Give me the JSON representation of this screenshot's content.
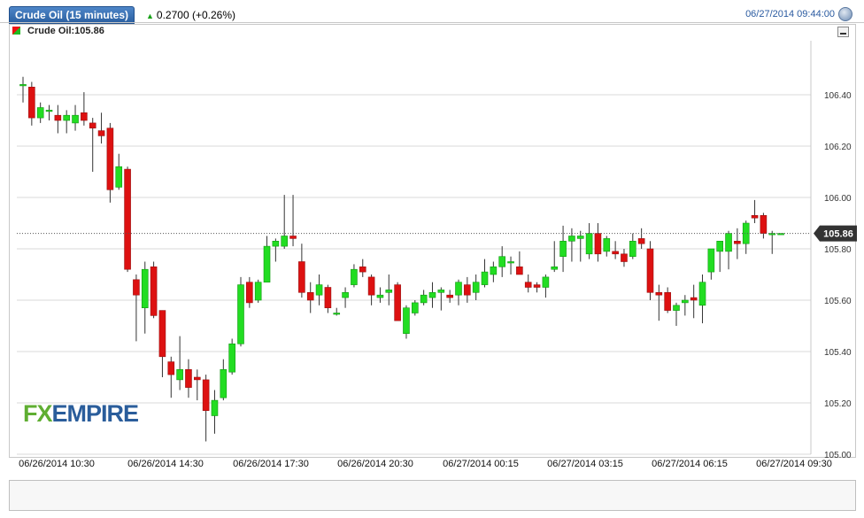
{
  "header": {
    "instrument_tab": "Crude Oil (15 minutes)",
    "change_text": "0.2700 (+0.26%)",
    "datetime": "06/27/2014 09:44:00"
  },
  "legend": {
    "label": "Crude Oil:105.86"
  },
  "logo": {
    "part1": "FX",
    "part2": "EMPIRE"
  },
  "colors": {
    "up": "#22dd22",
    "down": "#dd1111",
    "grid": "#d9d9d9",
    "accent": "#2a5aa0"
  },
  "chart_data": {
    "type": "candlestick",
    "last_price": 105.86,
    "last_price_label": "105.86",
    "ylim": [
      105.0,
      106.6
    ],
    "yticks": [
      105.0,
      105.2,
      105.4,
      105.6,
      105.8,
      106.0,
      106.2,
      106.4
    ],
    "ytick_labels": [
      "105.00",
      "105.20",
      "105.40",
      "105.60",
      "105.80",
      "106.00",
      "106.20",
      "106.40"
    ],
    "xtick_labels": [
      "06/26/2014 10:30",
      "06/26/2014 14:30",
      "06/26/2014 17:30",
      "06/26/2014 20:30",
      "06/27/2014 00:15",
      "06/27/2014 03:15",
      "06/27/2014 06:15",
      "06/27/2014 09:30"
    ],
    "candles": [
      [
        106.44,
        106.47,
        106.37,
        106.44
      ],
      [
        106.43,
        106.45,
        106.28,
        106.31
      ],
      [
        106.31,
        106.37,
        106.29,
        106.35
      ],
      [
        106.34,
        106.36,
        106.3,
        106.34
      ],
      [
        106.32,
        106.36,
        106.25,
        106.3
      ],
      [
        106.3,
        106.34,
        106.25,
        106.32
      ],
      [
        106.29,
        106.36,
        106.26,
        106.32
      ],
      [
        106.33,
        106.41,
        106.28,
        106.3
      ],
      [
        106.29,
        106.31,
        106.1,
        106.27
      ],
      [
        106.26,
        106.33,
        106.21,
        106.24
      ],
      [
        106.27,
        106.29,
        105.98,
        106.03
      ],
      [
        106.04,
        106.17,
        106.03,
        106.12
      ],
      [
        106.11,
        106.12,
        105.71,
        105.72
      ],
      [
        105.68,
        105.7,
        105.44,
        105.62
      ],
      [
        105.57,
        105.75,
        105.47,
        105.72
      ],
      [
        105.73,
        105.75,
        105.53,
        105.54
      ],
      [
        105.56,
        105.56,
        105.3,
        105.38
      ],
      [
        105.36,
        105.38,
        105.22,
        105.31
      ],
      [
        105.29,
        105.46,
        105.25,
        105.33
      ],
      [
        105.33,
        105.37,
        105.22,
        105.26
      ],
      [
        105.3,
        105.33,
        105.21,
        105.29
      ],
      [
        105.29,
        105.31,
        105.05,
        105.17
      ],
      [
        105.15,
        105.25,
        105.08,
        105.21
      ],
      [
        105.22,
        105.37,
        105.21,
        105.33
      ],
      [
        105.32,
        105.45,
        105.31,
        105.43
      ],
      [
        105.43,
        105.69,
        105.42,
        105.66
      ],
      [
        105.67,
        105.69,
        105.57,
        105.59
      ],
      [
        105.6,
        105.68,
        105.59,
        105.67
      ],
      [
        105.67,
        105.85,
        105.67,
        105.81
      ],
      [
        105.81,
        105.84,
        105.75,
        105.83
      ],
      [
        105.81,
        106.01,
        105.8,
        105.85
      ],
      [
        105.85,
        106.01,
        105.81,
        105.84
      ],
      [
        105.75,
        105.82,
        105.61,
        105.63
      ],
      [
        105.63,
        105.67,
        105.55,
        105.6
      ],
      [
        105.62,
        105.7,
        105.58,
        105.66
      ],
      [
        105.65,
        105.66,
        105.55,
        105.57
      ],
      [
        105.55,
        105.57,
        105.54,
        105.55
      ],
      [
        105.61,
        105.65,
        105.57,
        105.63
      ],
      [
        105.66,
        105.74,
        105.65,
        105.72
      ],
      [
        105.73,
        105.76,
        105.69,
        105.71
      ],
      [
        105.69,
        105.7,
        105.58,
        105.62
      ],
      [
        105.61,
        105.65,
        105.59,
        105.62
      ],
      [
        105.63,
        105.7,
        105.58,
        105.64
      ],
      [
        105.66,
        105.67,
        105.52,
        105.52
      ],
      [
        105.47,
        105.58,
        105.45,
        105.57
      ],
      [
        105.55,
        105.6,
        105.54,
        105.59
      ],
      [
        105.59,
        105.64,
        105.58,
        105.62
      ],
      [
        105.61,
        105.67,
        105.57,
        105.63
      ],
      [
        105.63,
        105.65,
        105.56,
        105.64
      ],
      [
        105.62,
        105.64,
        105.59,
        105.61
      ],
      [
        105.62,
        105.68,
        105.58,
        105.67
      ],
      [
        105.66,
        105.69,
        105.59,
        105.62
      ],
      [
        105.63,
        105.7,
        105.6,
        105.67
      ],
      [
        105.66,
        105.76,
        105.65,
        105.71
      ],
      [
        105.7,
        105.75,
        105.67,
        105.73
      ],
      [
        105.73,
        105.81,
        105.69,
        105.77
      ],
      [
        105.75,
        105.77,
        105.7,
        105.75
      ],
      [
        105.73,
        105.79,
        105.7,
        105.7
      ],
      [
        105.67,
        105.7,
        105.63,
        105.65
      ],
      [
        105.66,
        105.67,
        105.63,
        105.65
      ],
      [
        105.65,
        105.7,
        105.61,
        105.69
      ],
      [
        105.72,
        105.83,
        105.71,
        105.73
      ],
      [
        105.77,
        105.89,
        105.71,
        105.83
      ],
      [
        105.83,
        105.88,
        105.75,
        105.85
      ],
      [
        105.84,
        105.87,
        105.75,
        105.85
      ],
      [
        105.78,
        105.9,
        105.76,
        105.86
      ],
      [
        105.86,
        105.9,
        105.75,
        105.78
      ],
      [
        105.79,
        105.85,
        105.77,
        105.84
      ],
      [
        105.79,
        105.83,
        105.76,
        105.78
      ],
      [
        105.78,
        105.8,
        105.73,
        105.75
      ],
      [
        105.77,
        105.86,
        105.76,
        105.83
      ],
      [
        105.84,
        105.88,
        105.8,
        105.82
      ],
      [
        105.8,
        105.83,
        105.6,
        105.63
      ],
      [
        105.63,
        105.66,
        105.52,
        105.62
      ],
      [
        105.63,
        105.65,
        105.55,
        105.56
      ],
      [
        105.56,
        105.59,
        105.5,
        105.58
      ],
      [
        105.59,
        105.62,
        105.54,
        105.6
      ],
      [
        105.61,
        105.66,
        105.53,
        105.6
      ],
      [
        105.58,
        105.7,
        105.51,
        105.67
      ],
      [
        105.71,
        105.79,
        105.68,
        105.8
      ],
      [
        105.79,
        105.83,
        105.71,
        105.83
      ],
      [
        105.79,
        105.87,
        105.72,
        105.86
      ],
      [
        105.83,
        105.88,
        105.76,
        105.82
      ],
      [
        105.82,
        105.91,
        105.78,
        105.9
      ],
      [
        105.93,
        105.99,
        105.9,
        105.92
      ],
      [
        105.93,
        105.94,
        105.84,
        105.86
      ],
      [
        105.86,
        105.87,
        105.78,
        105.86
      ],
      [
        105.86,
        105.86,
        105.86,
        105.86
      ]
    ]
  }
}
